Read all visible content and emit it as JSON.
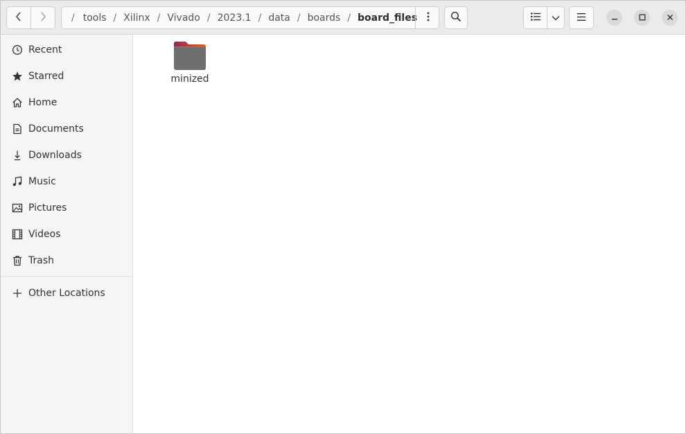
{
  "header": {
    "path": {
      "root_separator": "/",
      "separator": "/",
      "segments": [
        "tools",
        "Xilinx",
        "Vivado",
        "2023.1",
        "data",
        "boards",
        "board_files"
      ]
    },
    "icons": {
      "back": "chevron-left-icon",
      "forward": "chevron-right-icon",
      "path_menu": "vertical-ellipsis-icon",
      "search": "search-icon",
      "view_list": "list-view-icon",
      "view_options": "chevron-down-icon",
      "main_menu": "hamburger-menu-icon",
      "minimize": "minimize-icon",
      "maximize": "maximize-icon",
      "close": "close-icon"
    }
  },
  "sidebar": {
    "items": [
      {
        "label": "Recent",
        "icon": "clock-icon"
      },
      {
        "label": "Starred",
        "icon": "star-icon"
      },
      {
        "label": "Home",
        "icon": "home-icon"
      },
      {
        "label": "Documents",
        "icon": "document-icon"
      },
      {
        "label": "Downloads",
        "icon": "download-icon"
      },
      {
        "label": "Music",
        "icon": "music-icon"
      },
      {
        "label": "Pictures",
        "icon": "picture-icon"
      },
      {
        "label": "Videos",
        "icon": "video-icon"
      },
      {
        "label": "Trash",
        "icon": "trash-icon"
      }
    ],
    "other_locations": {
      "label": "Other Locations",
      "icon": "plus-icon"
    }
  },
  "content": {
    "files": [
      {
        "name": "minized",
        "type": "folder",
        "icon": "folder-icon"
      }
    ]
  },
  "colors": {
    "folder_body": "#6f6f6f",
    "folder_tab_start": "#8e2a52",
    "folder_tab_end": "#e3641f",
    "headerbar": "#ebebeb",
    "sidebar": "#f6f5f4"
  }
}
